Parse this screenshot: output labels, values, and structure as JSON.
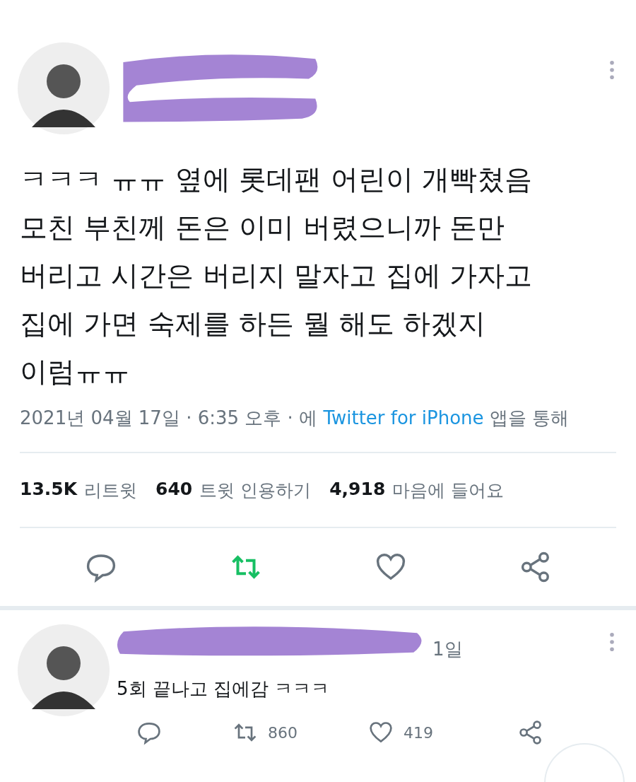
{
  "tweet": {
    "text": "ㅋㅋㅋ ㅠㅠ 옆에 롯데팬 어린이 개빡쳤음\n모친 부친께 돈은 이미 버렸으니까 돈만\n버리고 시간은 버리지 말자고 집에 가자고\n집에 가면 숙제를 하든 뭘 해도 하겠지\n이럼ㅠㅠ",
    "date": "2021년 04월 17일 · 6:35 오후 · 에",
    "source": "Twitter for iPhone",
    "source_suffix": "앱을 통해",
    "stats": [
      {
        "count": "13.5K",
        "label": "리트윗"
      },
      {
        "count": "640",
        "label": "트윗 인용하기"
      },
      {
        "count": "4,918",
        "label": "마음에 들어요"
      }
    ],
    "retweeted": true,
    "liked": false
  },
  "reply": {
    "time": "1일",
    "text": "5회 끝나고 집에감 ㅋㅋㅋ",
    "retweets": "860",
    "likes": "419",
    "retweeted": false,
    "liked": false
  }
}
